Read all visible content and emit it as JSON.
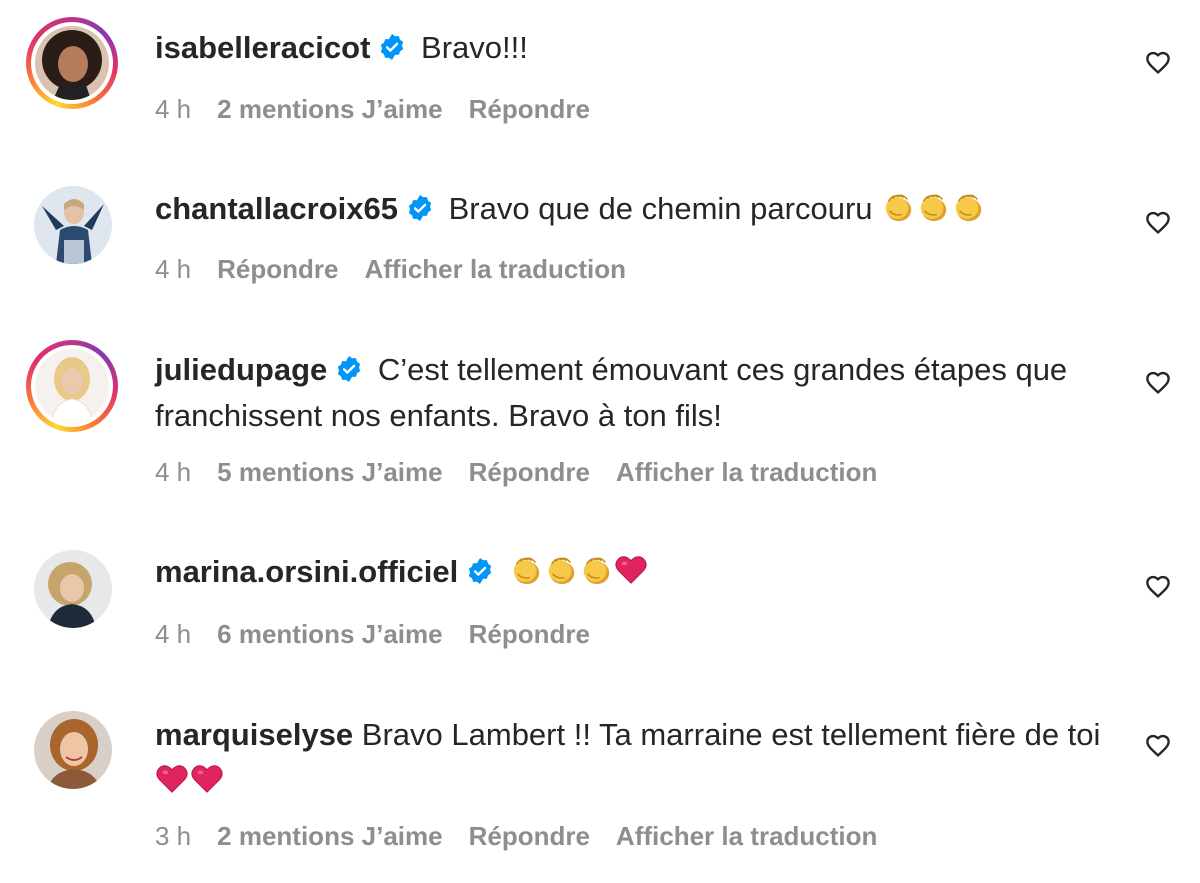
{
  "comments": [
    {
      "username": "isabelleracicot",
      "verified": true,
      "text": "Bravo!!!",
      "emojis": [],
      "time": "4 h",
      "likes": "2 mentions J’aime",
      "reply": "Répondre",
      "translate": ""
    },
    {
      "username": "chantallacroix65",
      "verified": true,
      "text": "Bravo que de chemin parcouru",
      "emojis": [
        "clapping-hands",
        "clapping-hands",
        "clapping-hands"
      ],
      "time": "4 h",
      "likes": "",
      "reply": "Répondre",
      "translate": "Afficher la traduction"
    },
    {
      "username": "juliedupage",
      "verified": true,
      "text": "C’est tellement émouvant ces grandes étapes que franchissent nos enfants. Bravo à ton fils!",
      "emojis": [],
      "time": "4 h",
      "likes": "5 mentions J’aime",
      "reply": "Répondre",
      "translate": "Afficher la traduction"
    },
    {
      "username": "marina.orsini.officiel",
      "verified": true,
      "text": "",
      "emojis": [
        "clapping-hands",
        "clapping-hands",
        "clapping-hands",
        "red-heart"
      ],
      "time": "4 h",
      "likes": "6 mentions J’aime",
      "reply": "Répondre",
      "translate": ""
    },
    {
      "username": "marquiselyse",
      "verified": false,
      "text": "Bravo Lambert !! Ta marraine est tellement fière de toi",
      "emojis": [
        "red-heart",
        "red-heart"
      ],
      "time": "3 h",
      "likes": "2 mentions J’aime",
      "reply": "Répondre",
      "translate": "Afficher la traduction"
    }
  ],
  "colors": {
    "text": "#262626",
    "secondary": "#8e8e8e",
    "verified": "#0095f6",
    "heart_emoji": "#e0245e",
    "clap_emoji": "#f5c242"
  }
}
